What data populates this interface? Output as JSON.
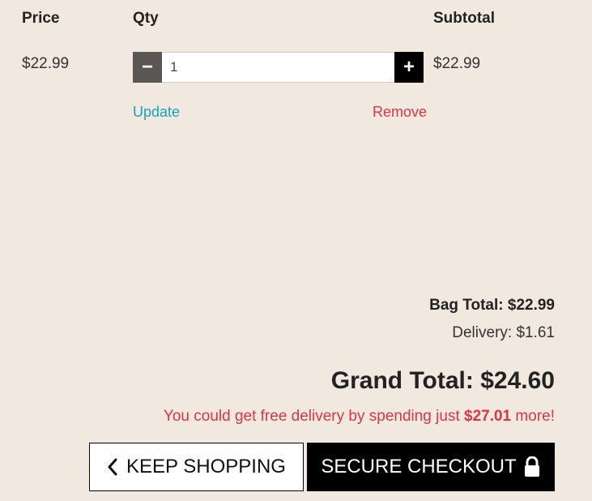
{
  "headers": {
    "price": "Price",
    "qty": "Qty",
    "subtotal": "Subtotal"
  },
  "item": {
    "price": "$22.99",
    "quantity": "1",
    "subtotal": "$22.99",
    "minus_symbol": "−",
    "plus_symbol": "+",
    "update_label": "Update",
    "remove_label": "Remove"
  },
  "summary": {
    "bag_total_label": "Bag Total:",
    "bag_total_value": "$22.99",
    "delivery_label": "Delivery:",
    "delivery_value": "$1.61",
    "grand_total_label": "Grand Total:",
    "grand_total_value": "$24.60",
    "free_delivery_prefix": "You could get free delivery by spending just",
    "free_delivery_amount": "$27.01",
    "free_delivery_suffix": "more!"
  },
  "buttons": {
    "keep_shopping": "KEEP SHOPPING",
    "secure_checkout": "SECURE CHECKOUT"
  },
  "icons": {
    "keep_shopping": "chevron-left-icon",
    "secure_checkout": "lock-icon"
  },
  "colors": {
    "background": "#f1e9df",
    "update_link": "#17a2b8",
    "remove_link": "#dc3545",
    "free_delivery_text": "#dc3545",
    "checkout_button": "#000000",
    "minus_button": "#5a5752"
  }
}
